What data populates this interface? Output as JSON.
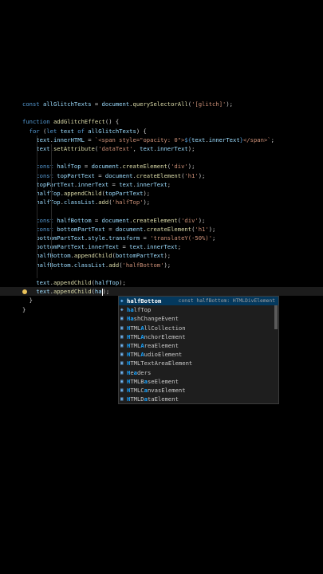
{
  "editor": {
    "lines": [
      [
        [
          "kw",
          "const "
        ],
        [
          "var",
          "allGlitchTexts"
        ],
        [
          "plain",
          " = "
        ],
        [
          "var",
          "document"
        ],
        [
          "plain",
          "."
        ],
        [
          "fn",
          "querySelectorAll"
        ],
        [
          "plain",
          "("
        ],
        [
          "str",
          "'[glitch]'"
        ],
        [
          "plain",
          ");"
        ]
      ],
      [],
      [
        [
          "kw",
          "function "
        ],
        [
          "fn",
          "addGlitchEffect"
        ],
        [
          "plain",
          "() {"
        ]
      ],
      [
        [
          "plain",
          "  "
        ],
        [
          "kw",
          "for "
        ],
        [
          "plain",
          "("
        ],
        [
          "kw",
          "let "
        ],
        [
          "var",
          "text "
        ],
        [
          "kw",
          "of "
        ],
        [
          "var",
          "allGlitchTexts"
        ],
        [
          "plain",
          ") {"
        ]
      ],
      [
        [
          "plain",
          "    "
        ],
        [
          "var",
          "text"
        ],
        [
          "plain",
          "."
        ],
        [
          "var",
          "innerHTML"
        ],
        [
          "plain",
          " = "
        ],
        [
          "str",
          "`<span style=\"opacity: 0\">"
        ],
        [
          "kw",
          "${"
        ],
        [
          "var",
          "text"
        ],
        [
          "plain",
          "."
        ],
        [
          "var",
          "innerText"
        ],
        [
          "kw",
          "}"
        ],
        [
          "str",
          "</span>`"
        ],
        [
          "plain",
          ";"
        ]
      ],
      [
        [
          "plain",
          "    "
        ],
        [
          "var",
          "text"
        ],
        [
          "plain",
          "."
        ],
        [
          "fn",
          "setAttribute"
        ],
        [
          "plain",
          "("
        ],
        [
          "str",
          "'dataText'"
        ],
        [
          "plain",
          ", "
        ],
        [
          "var",
          "text"
        ],
        [
          "plain",
          "."
        ],
        [
          "var",
          "innerText"
        ],
        [
          "plain",
          ");"
        ]
      ],
      [],
      [
        [
          "plain",
          "    "
        ],
        [
          "kw",
          "const "
        ],
        [
          "var",
          "halfTop"
        ],
        [
          "plain",
          " = "
        ],
        [
          "var",
          "document"
        ],
        [
          "plain",
          "."
        ],
        [
          "fn",
          "createElement"
        ],
        [
          "plain",
          "("
        ],
        [
          "str",
          "'div'"
        ],
        [
          "plain",
          ");"
        ]
      ],
      [
        [
          "plain",
          "    "
        ],
        [
          "kw",
          "const "
        ],
        [
          "var",
          "topPartText"
        ],
        [
          "plain",
          " = "
        ],
        [
          "var",
          "document"
        ],
        [
          "plain",
          "."
        ],
        [
          "fn",
          "createElement"
        ],
        [
          "plain",
          "("
        ],
        [
          "str",
          "'h1'"
        ],
        [
          "plain",
          ");"
        ]
      ],
      [
        [
          "plain",
          "    "
        ],
        [
          "var",
          "topPartText"
        ],
        [
          "plain",
          "."
        ],
        [
          "var",
          "innerText"
        ],
        [
          "plain",
          " = "
        ],
        [
          "var",
          "text"
        ],
        [
          "plain",
          "."
        ],
        [
          "var",
          "innerText"
        ],
        [
          "plain",
          ";"
        ]
      ],
      [
        [
          "plain",
          "    "
        ],
        [
          "var",
          "halfTop"
        ],
        [
          "plain",
          "."
        ],
        [
          "fn",
          "appendChild"
        ],
        [
          "plain",
          "("
        ],
        [
          "var",
          "topPartText"
        ],
        [
          "plain",
          ");"
        ]
      ],
      [
        [
          "plain",
          "    "
        ],
        [
          "var",
          "halfTop"
        ],
        [
          "plain",
          "."
        ],
        [
          "var",
          "classList"
        ],
        [
          "plain",
          "."
        ],
        [
          "fn",
          "add"
        ],
        [
          "plain",
          "("
        ],
        [
          "str",
          "'halfTop'"
        ],
        [
          "plain",
          ");"
        ]
      ],
      [],
      [
        [
          "plain",
          "    "
        ],
        [
          "kw",
          "const "
        ],
        [
          "var",
          "halfBottom"
        ],
        [
          "plain",
          " = "
        ],
        [
          "var",
          "document"
        ],
        [
          "plain",
          "."
        ],
        [
          "fn",
          "createElement"
        ],
        [
          "plain",
          "("
        ],
        [
          "str",
          "'div'"
        ],
        [
          "plain",
          ");"
        ]
      ],
      [
        [
          "plain",
          "    "
        ],
        [
          "kw",
          "const "
        ],
        [
          "var",
          "bottomPartText"
        ],
        [
          "plain",
          " = "
        ],
        [
          "var",
          "document"
        ],
        [
          "plain",
          "."
        ],
        [
          "fn",
          "createElement"
        ],
        [
          "plain",
          "("
        ],
        [
          "str",
          "'h1'"
        ],
        [
          "plain",
          ");"
        ]
      ],
      [
        [
          "plain",
          "    "
        ],
        [
          "var",
          "bottomPartText"
        ],
        [
          "plain",
          "."
        ],
        [
          "var",
          "style"
        ],
        [
          "plain",
          "."
        ],
        [
          "var",
          "transform"
        ],
        [
          "plain",
          " = "
        ],
        [
          "str",
          "'translateY(-50%)'"
        ],
        [
          "plain",
          ";"
        ]
      ],
      [
        [
          "plain",
          "    "
        ],
        [
          "var",
          "bottomPartText"
        ],
        [
          "plain",
          "."
        ],
        [
          "var",
          "innerText"
        ],
        [
          "plain",
          " = "
        ],
        [
          "var",
          "text"
        ],
        [
          "plain",
          "."
        ],
        [
          "var",
          "innerText"
        ],
        [
          "plain",
          ";"
        ]
      ],
      [
        [
          "plain",
          "    "
        ],
        [
          "var",
          "halfBottom"
        ],
        [
          "plain",
          "."
        ],
        [
          "fn",
          "appendChild"
        ],
        [
          "plain",
          "("
        ],
        [
          "var",
          "bottomPartText"
        ],
        [
          "plain",
          ");"
        ]
      ],
      [
        [
          "plain",
          "    "
        ],
        [
          "var",
          "halfBottom"
        ],
        [
          "plain",
          "."
        ],
        [
          "var",
          "classList"
        ],
        [
          "plain",
          "."
        ],
        [
          "fn",
          "add"
        ],
        [
          "plain",
          "("
        ],
        [
          "str",
          "'halfBottom'"
        ],
        [
          "plain",
          ");"
        ]
      ],
      [],
      [
        [
          "plain",
          "    "
        ],
        [
          "var",
          "text"
        ],
        [
          "plain",
          "."
        ],
        [
          "fn",
          "appendChild"
        ],
        [
          "plain",
          "("
        ],
        [
          "var",
          "halfTop"
        ],
        [
          "plain",
          ");"
        ]
      ],
      [
        [
          "plain",
          "    "
        ],
        [
          "var",
          "text"
        ],
        [
          "plain",
          "."
        ],
        [
          "fn",
          "appendChild"
        ],
        [
          "plain",
          "("
        ],
        [
          "var",
          "ha"
        ],
        [
          "cursor",
          ""
        ],
        [
          "plain",
          ");"
        ]
      ],
      [
        [
          "plain",
          "  }"
        ]
      ],
      [
        [
          "plain",
          "}"
        ]
      ]
    ],
    "colors": {
      "keyword": "#569cd6",
      "function": "#dcdcaa",
      "string": "#ce9178",
      "variable": "#9cdcfe",
      "text": "#d4d4d4",
      "background": "#000000"
    }
  },
  "suggest": {
    "items": [
      {
        "icon": "variable-icon",
        "match": "h",
        "rest": "alfBottom",
        "matchAll": true,
        "detail": "const halfBottom: HTMLDivElement"
      },
      {
        "icon": "variable-icon",
        "match": "ha",
        "rest": "lfTop",
        "matchAll": true,
        "detail": ""
      },
      {
        "icon": "class-icon",
        "parts": [
          [
            "b",
            "Ha"
          ],
          [
            "t",
            "shChangeEvent"
          ]
        ],
        "detail": ""
      },
      {
        "icon": "class-icon",
        "parts": [
          [
            "b",
            "H"
          ],
          [
            "t",
            "TML"
          ],
          [
            "b",
            "A"
          ],
          [
            "t",
            "llCollection"
          ]
        ],
        "detail": ""
      },
      {
        "icon": "class-icon",
        "parts": [
          [
            "b",
            "H"
          ],
          [
            "t",
            "TML"
          ],
          [
            "b",
            "A"
          ],
          [
            "t",
            "nchorElement"
          ]
        ],
        "detail": ""
      },
      {
        "icon": "class-icon",
        "parts": [
          [
            "b",
            "H"
          ],
          [
            "t",
            "TML"
          ],
          [
            "b",
            "A"
          ],
          [
            "t",
            "reaElement"
          ]
        ],
        "detail": ""
      },
      {
        "icon": "class-icon",
        "parts": [
          [
            "b",
            "H"
          ],
          [
            "t",
            "TML"
          ],
          [
            "b",
            "A"
          ],
          [
            "t",
            "udioElement"
          ]
        ],
        "detail": ""
      },
      {
        "icon": "class-icon",
        "parts": [
          [
            "b",
            "H"
          ],
          [
            "t",
            "TMLTextAreaElement"
          ]
        ],
        "detail": ""
      },
      {
        "icon": "class-icon",
        "parts": [
          [
            "b",
            "H"
          ],
          [
            "t",
            "e"
          ],
          [
            "b",
            "a"
          ],
          [
            "t",
            "ders"
          ]
        ],
        "detail": ""
      },
      {
        "icon": "class-icon",
        "parts": [
          [
            "b",
            "H"
          ],
          [
            "t",
            "TMLB"
          ],
          [
            "b",
            "a"
          ],
          [
            "t",
            "seElement"
          ]
        ],
        "detail": ""
      },
      {
        "icon": "class-icon",
        "parts": [
          [
            "b",
            "H"
          ],
          [
            "t",
            "TMLC"
          ],
          [
            "b",
            "a"
          ],
          [
            "t",
            "nvasElement"
          ]
        ],
        "detail": ""
      },
      {
        "icon": "class-icon",
        "parts": [
          [
            "b",
            "H"
          ],
          [
            "t",
            "TMLD"
          ],
          [
            "b",
            "a"
          ],
          [
            "t",
            "taElement"
          ]
        ],
        "detail": ""
      }
    ]
  }
}
